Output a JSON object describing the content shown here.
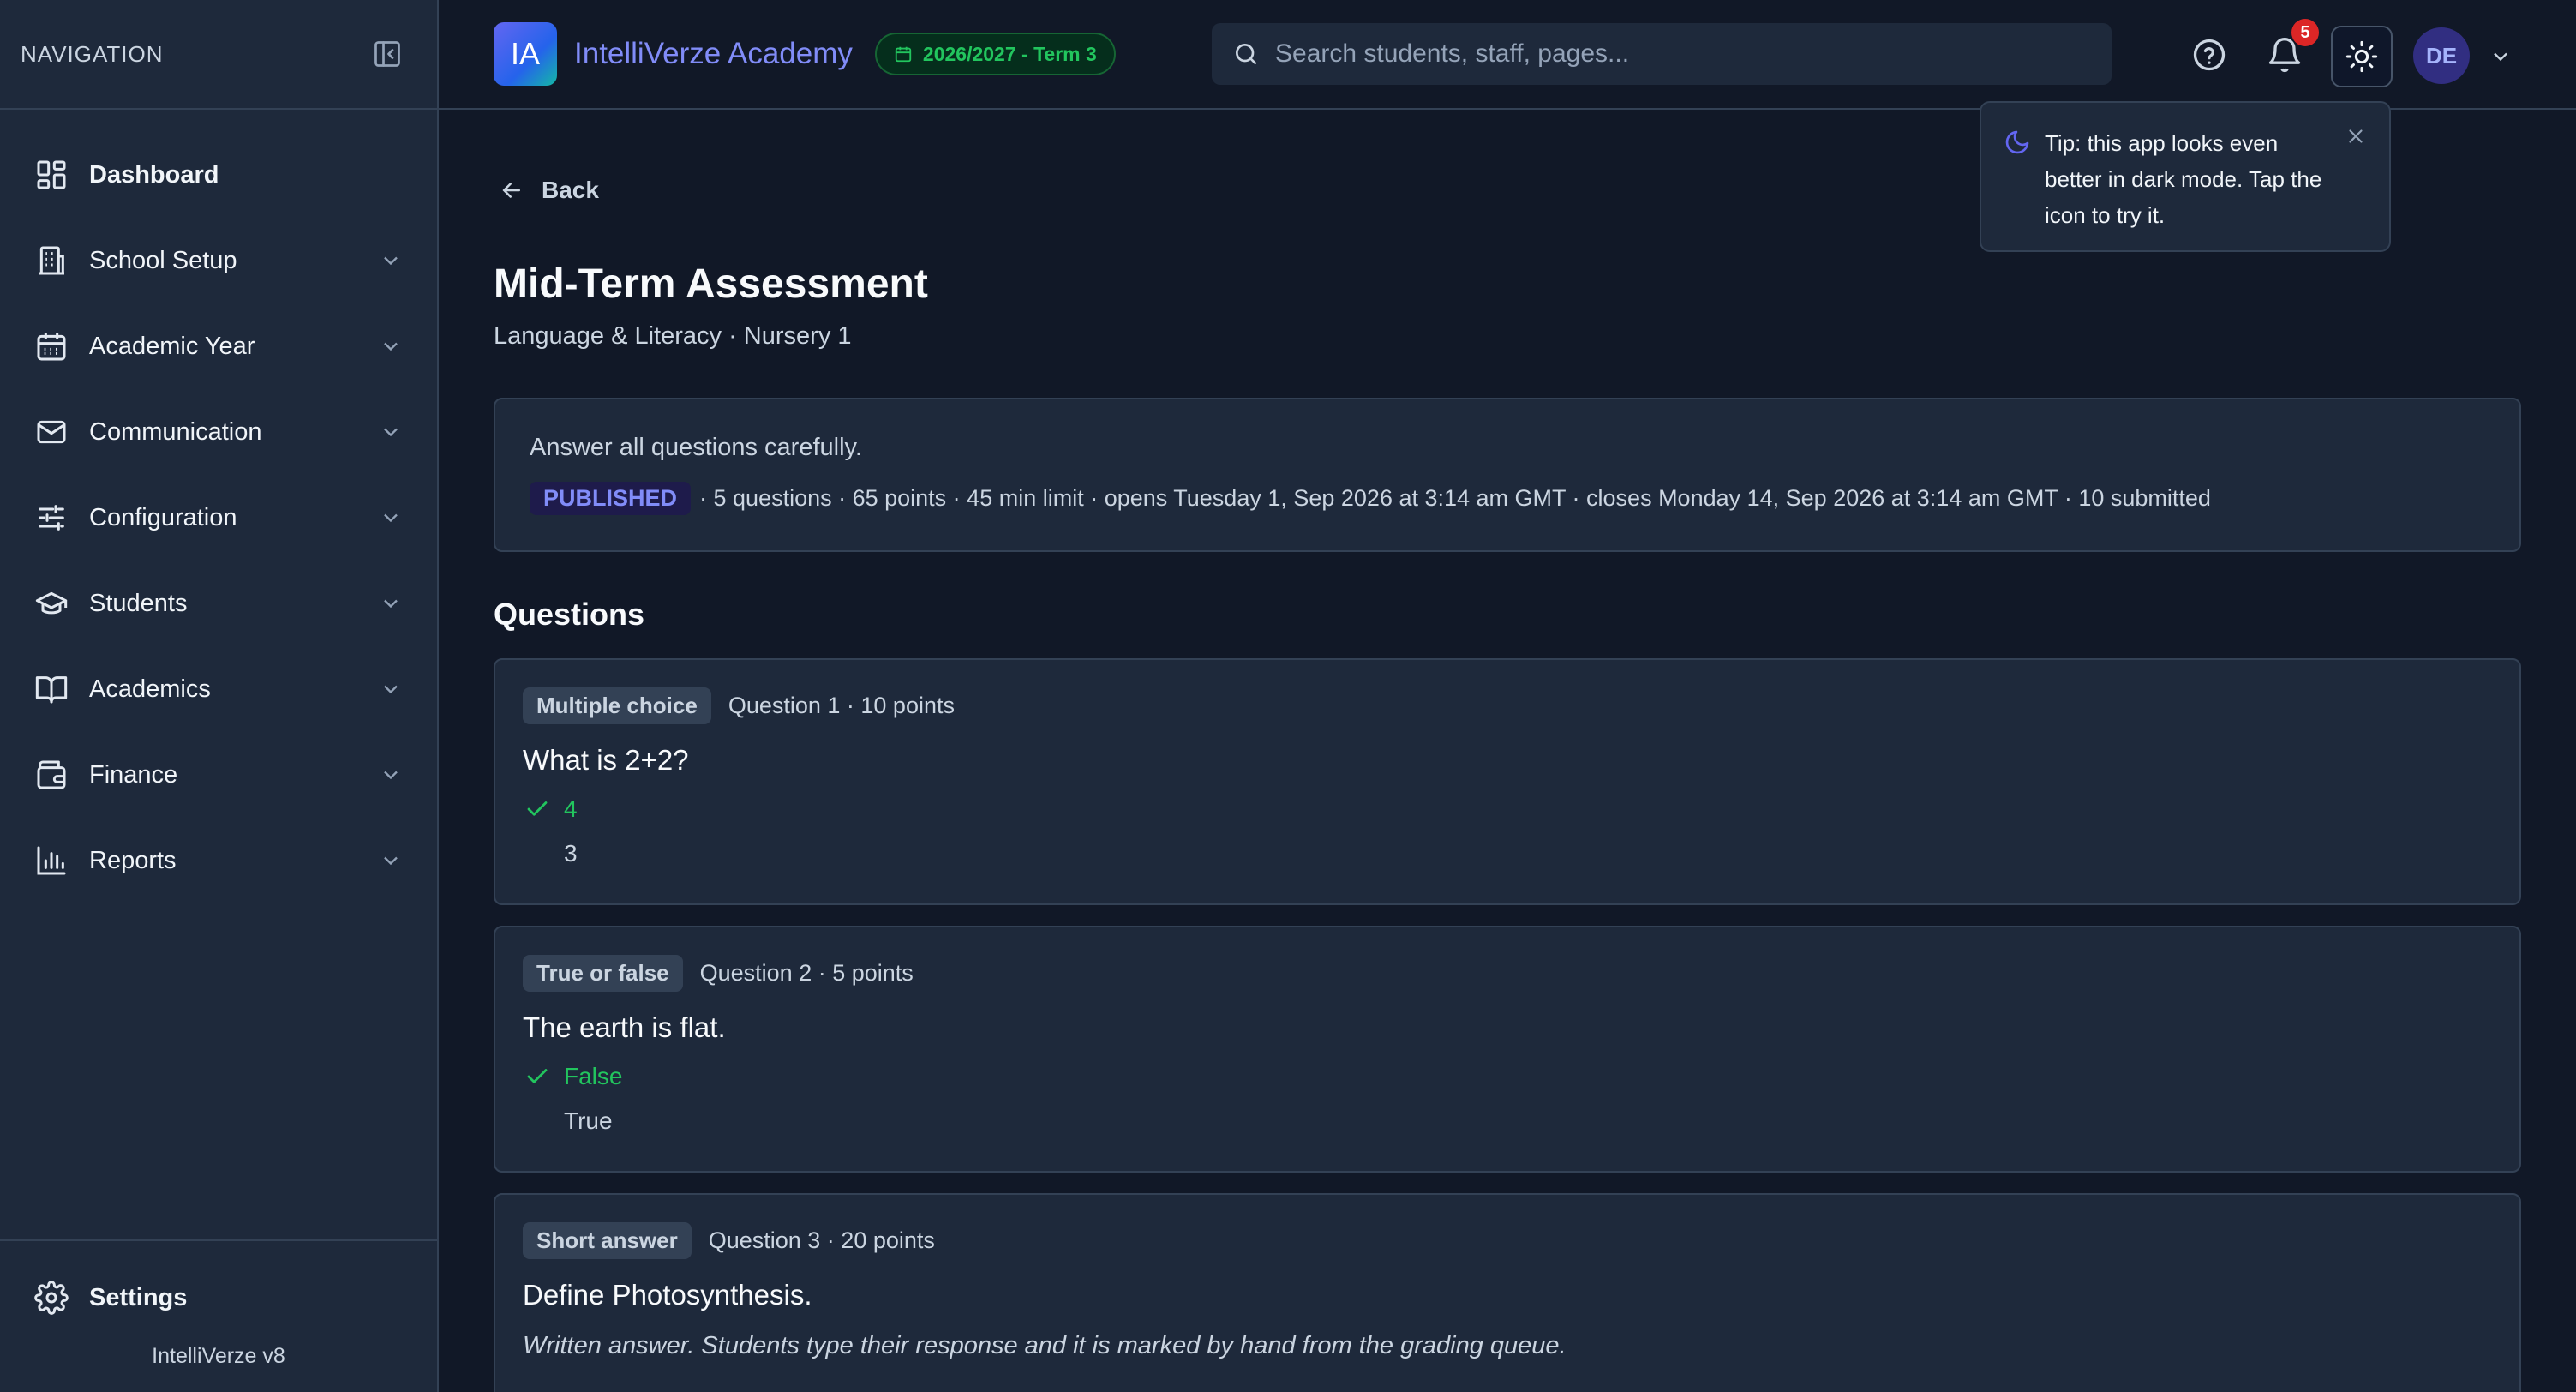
{
  "sidebar": {
    "nav_title": "NAVIGATION",
    "items": [
      {
        "label": "Dashboard",
        "icon": "dashboard-icon"
      },
      {
        "label": "School Setup",
        "icon": "building-icon"
      },
      {
        "label": "Academic Year",
        "icon": "calendar-icon"
      },
      {
        "label": "Communication",
        "icon": "mail-icon"
      },
      {
        "label": "Configuration",
        "icon": "sliders-icon"
      },
      {
        "label": "Students",
        "icon": "graduation-cap-icon"
      },
      {
        "label": "Academics",
        "icon": "book-icon"
      },
      {
        "label": "Finance",
        "icon": "wallet-icon"
      },
      {
        "label": "Reports",
        "icon": "bar-chart-icon"
      }
    ],
    "settings_label": "Settings",
    "version": "IntelliVerze v8"
  },
  "topbar": {
    "logo_text": "IA",
    "app_name": "IntelliVerze Academy",
    "term": "2026/2027 - Term 3",
    "search_placeholder": "Search students, staff, pages...",
    "notification_count": "5",
    "avatar_initials": "DE"
  },
  "tip": {
    "text": "Tip: this app looks even better in dark mode. Tap the icon to try it."
  },
  "page": {
    "back_label": "Back",
    "title": "Mid-Term Assessment",
    "subtitle": "Language & Literacy · Nursery 1",
    "description": "Answer all questions carefully.",
    "status": "PUBLISHED",
    "meta": "· 5 questions · 65 points · 45 min limit · opens Tuesday 1, Sep 2026 at 3:14 am GMT · closes Monday 14, Sep 2026 at 3:14 am GMT · 10 submitted",
    "questions_heading": "Questions"
  },
  "questions": [
    {
      "type": "Multiple choice",
      "meta": "Question 1 · 10 points",
      "text": "What is 2+2?",
      "correct": "4",
      "other": "3"
    },
    {
      "type": "True or false",
      "meta": "Question 2 · 5 points",
      "text": "The earth is flat.",
      "correct": "False",
      "other": "True"
    },
    {
      "type": "Short answer",
      "meta": "Question 3 · 20 points",
      "text": "Define Photosynthesis.",
      "note": "Written answer. Students type their response and it is marked by hand from the grading queue."
    }
  ],
  "colors": {
    "accent": "#818cf8",
    "success": "#22c55e",
    "danger": "#dc2626",
    "background": "#111827",
    "surface": "#1e293b"
  }
}
